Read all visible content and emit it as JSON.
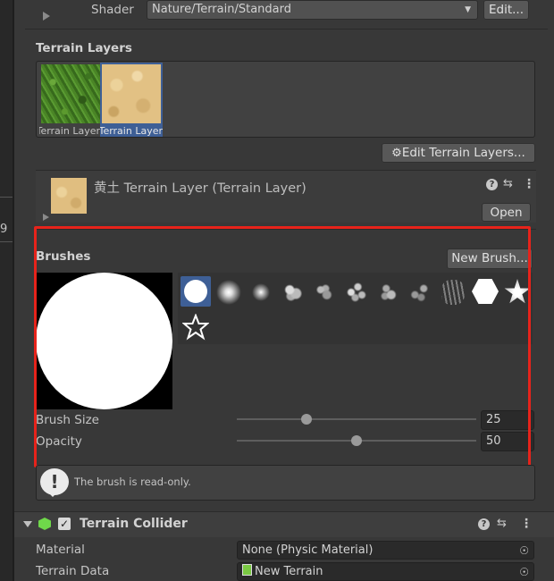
{
  "shader": {
    "label": "Shader",
    "value": "Nature/Terrain/Standard",
    "edit_label": "Edit..."
  },
  "terrain_layers": {
    "heading": "Terrain Layers",
    "items": [
      {
        "label": "黄土 Terrain Layer",
        "texture": "grass"
      },
      {
        "label": "黄土 Terrain Layer",
        "texture": "sand",
        "selected": true
      }
    ],
    "edit_button": "Edit Terrain Layers..."
  },
  "layer_inspector": {
    "title": "黄土 Terrain Layer (Terrain Layer)",
    "open_label": "Open"
  },
  "brushes": {
    "heading": "Brushes",
    "new_brush_label": "New Brush...",
    "brush_size_label": "Brush Size",
    "brush_size_value": "25",
    "brush_size_fraction": 0.29,
    "opacity_label": "Opacity",
    "opacity_value": "50",
    "opacity_fraction": 0.5
  },
  "readonly_notice": "The brush is read-only.",
  "terrain_collider": {
    "title": "Terrain Collider",
    "enabled": true,
    "material_label": "Material",
    "material_value": "None (Physic Material)",
    "terrain_data_label": "Terrain Data",
    "terrain_data_value": "New Terrain"
  },
  "left_strip": {
    "value": "9"
  },
  "colors": {
    "accent": "#3e5f96",
    "highlight_border": "#e7231b",
    "panel_bg": "#383838"
  }
}
